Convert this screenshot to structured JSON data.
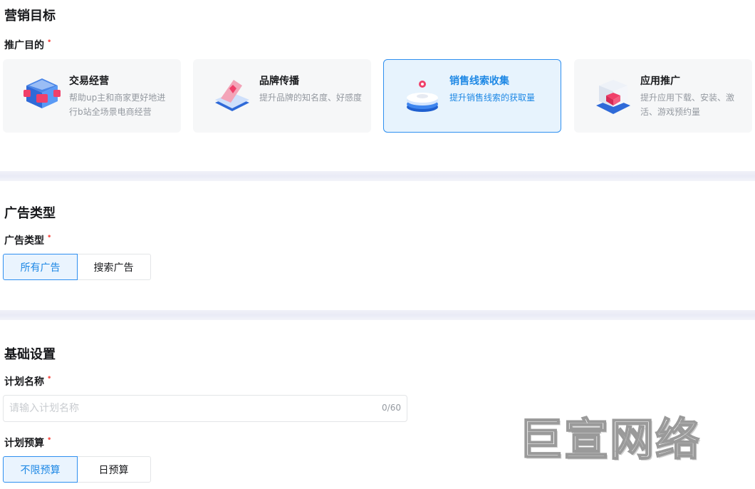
{
  "marketing": {
    "section_title": "营销目标",
    "field_label": "推广目的",
    "required_mark": "•",
    "cards": [
      {
        "title": "交易经营",
        "desc": "帮助up主和商家更好地进行b站全场景电商经营",
        "icon": "shop-box-icon",
        "selected": false
      },
      {
        "title": "品牌传播",
        "desc": "提升品牌的知名度、好感度",
        "icon": "brand-heart-icon",
        "selected": false
      },
      {
        "title": "销售线索收集",
        "desc": "提升销售线索的获取量",
        "icon": "lead-stack-icon",
        "selected": true
      },
      {
        "title": "应用推广",
        "desc": "提升应用下载、安装、激活、游戏预约量",
        "icon": "app-cube-icon",
        "selected": false
      }
    ]
  },
  "ad_type": {
    "section_title": "广告类型",
    "field_label": "广告类型",
    "options": [
      "所有广告",
      "搜索广告"
    ],
    "selected": "所有广告"
  },
  "basic": {
    "section_title": "基础设置",
    "plan_name_label": "计划名称",
    "plan_name_placeholder": "请输入计划名称",
    "plan_name_value": "",
    "plan_name_counter": "0/60",
    "budget_label": "计划预算",
    "budget_options": [
      "不限预算",
      "日预算"
    ],
    "budget_selected": "不限预算"
  },
  "watermark": "巨宣网络",
  "colors": {
    "accent": "#2e8ff0",
    "accent_text": "#1e88e5",
    "selected_bg": "#e7f3fd",
    "required": "#f85a54"
  }
}
